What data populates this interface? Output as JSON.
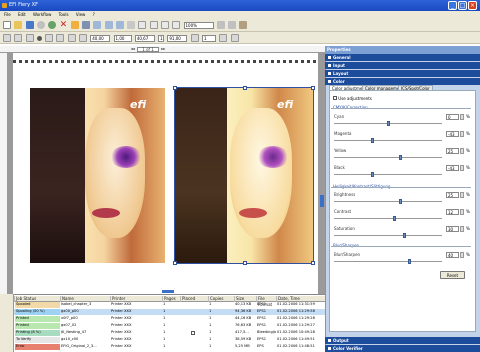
{
  "window": {
    "title": "EFI Fiery XF"
  },
  "menu": {
    "items": [
      "File",
      "Edit",
      "Workflow",
      "Tools",
      "View",
      "?"
    ]
  },
  "toolbar": {
    "zoom_value": "100%",
    "x_value": "40,00",
    "y_value": "1,00",
    "w_value": "40,67",
    "h_value": "1",
    "pct_value": "91,00",
    "misc_value": "1",
    "page_nav": "1 of 1"
  },
  "properties": {
    "title": "Properties",
    "sections": [
      "General",
      "Input",
      "Layout",
      "Color"
    ],
    "bottom_sections": [
      "Output",
      "Color Verifier"
    ],
    "tabs": [
      "Color adjustment",
      "Color management",
      "ICS/Spot/Color"
    ],
    "use_adjustments_label": "Use adjustments",
    "cmyk_group": "CMY/K/Correction",
    "cmyk": [
      {
        "label": "Cyan",
        "value": "0",
        "unit": "%",
        "pos": 0.5
      },
      {
        "label": "Magenta",
        "value": "-43",
        "unit": "%",
        "pos": 0.36
      },
      {
        "label": "Yellow",
        "value": "25",
        "unit": "%",
        "pos": 0.62
      },
      {
        "label": "Black",
        "value": "-43",
        "unit": "%",
        "pos": 0.36
      }
    ],
    "bcs_group": "Helligkeit/Kontrast/Sättigung",
    "bcs": [
      {
        "label": "Brightness",
        "value": "25",
        "unit": "%",
        "pos": 0.62
      },
      {
        "label": "Contrast",
        "value": "12",
        "unit": "%",
        "pos": 0.56
      },
      {
        "label": "Saturation",
        "value": "30",
        "unit": "%",
        "pos": 0.65
      }
    ],
    "blur_group": "Blur/Sharpen",
    "blur": {
      "label": "Blur/Sharpen",
      "value": "40",
      "unit": "%",
      "pos": 0.7
    },
    "reset_label": "Reset"
  },
  "joblist": {
    "headers": [
      "Job Status",
      "Name",
      "Printer",
      "Pages",
      "Placed",
      "Copies",
      "Size",
      "File Format",
      "Date, Time"
    ],
    "rows": [
      {
        "status": "Spooled",
        "name": "Isabel_chapter_3",
        "printer": "Printer XXX",
        "pages": "1",
        "placed": "",
        "copies": "1",
        "size": "40,13 KB",
        "format": "EPS1",
        "date": "01.02.2006 11:31:59",
        "color": "#f1d9a8"
      },
      {
        "status": "Spooling (50 %)",
        "name": "gx00_p00",
        "printer": "Printer XXX",
        "pages": "1",
        "placed": "",
        "copies": "1",
        "size": "94,36 KB",
        "format": "EPS1",
        "date": "01.02.2006 11:29:58",
        "color": "#9ed2f2"
      },
      {
        "status": "Printed",
        "name": "x0f7_p00",
        "printer": "Printer XXX",
        "pages": "1",
        "placed": "",
        "copies": "1",
        "size": "44,16 KB",
        "format": "EPS1",
        "date": "01.02.2006 11:29:28",
        "color": "#b8e8b0"
      },
      {
        "status": "Printed",
        "name": "gx07_02",
        "printer": "Printer XXX",
        "pages": "1",
        "placed": "",
        "copies": "1",
        "size": "76,63 KB",
        "format": "EPS1",
        "date": "01.02.2006 11:29:27",
        "color": "#b8e8b0"
      },
      {
        "status": "Printing (8 %)",
        "name": "JK_Nesting_47",
        "printer": "Printer XXX",
        "pages": "1",
        "placed": "check",
        "copies": "1",
        "size": "417,5...",
        "format": "Bleeding(bl)",
        "date": "01.02.2006 10:49:28",
        "color": "#a8dcc0"
      },
      {
        "status": "To Verify",
        "name": "gx10_c00",
        "printer": "Printer XXX",
        "pages": "1",
        "placed": "",
        "copies": "1",
        "size": "38,59 KB",
        "format": "EPS1",
        "date": "01.02.2006 11:49:51",
        "color": "#e6e6e6"
      },
      {
        "status": "Error",
        "name": "EFIG_Original_2_3...",
        "printer": "Printer XXX",
        "pages": "1",
        "placed": "",
        "copies": "1",
        "size": "5,25 MB",
        "format": "EPS",
        "date": "01.02.2006 11:48:51",
        "color": "#e88070"
      }
    ]
  },
  "colors": {
    "titlebar": "#1a49c0",
    "panel_header": "#1d4c9c",
    "panel_bg": "#c3d3ea"
  }
}
